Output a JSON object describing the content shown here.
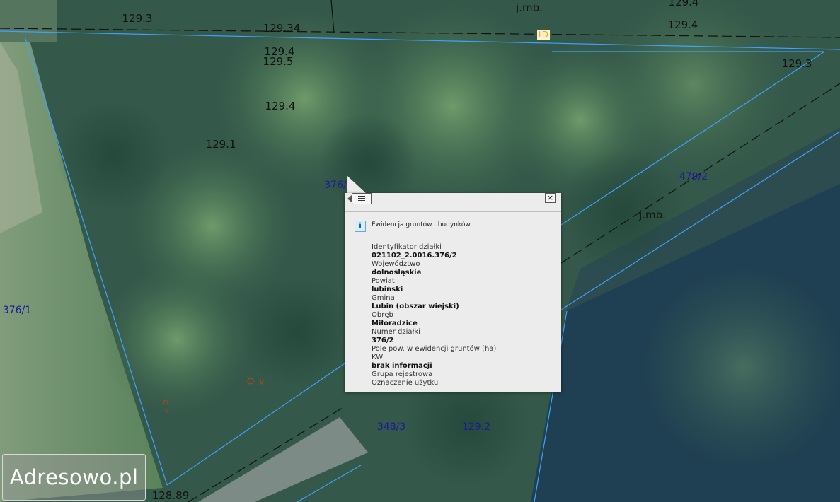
{
  "colors": {
    "parcel_line": "#3fa2ff",
    "dashed_line": "#111111",
    "parcel_label": "#1a1a9a",
    "popup_bg": "#ececec"
  },
  "map": {
    "elevations": [
      "129.3",
      "129.34",
      "129.4",
      "129.5",
      "129.4",
      "129.1",
      "129.4",
      "129.4",
      "129.3",
      "128.89",
      "j.mb.",
      "j.mb."
    ],
    "parcels": [
      "376/",
      "376/1",
      "479/2",
      "348/3",
      "129.2"
    ],
    "marker_label": "tD",
    "point_label": "k"
  },
  "popup": {
    "list_icon": "list-icon",
    "close_icon": "close-icon",
    "close_symbol": "×",
    "info_icon_symbol": "i",
    "title": "Ewidencja gruntów i budynków",
    "fields": [
      {
        "label": "Identyfikator działki",
        "value": "021102_2.0016.376/2"
      },
      {
        "label": "Województwo",
        "value": "dolnośląskie"
      },
      {
        "label": "Powiat",
        "value": "lubiński"
      },
      {
        "label": "Gmina",
        "value": "Lubin (obszar wiejski)"
      },
      {
        "label": "Obręb",
        "value": "Miłoradzice"
      },
      {
        "label": "Numer działki",
        "value": "376/2"
      },
      {
        "label": "Pole pow. w ewidencji gruntów (ha)",
        "value": ""
      },
      {
        "label": "KW",
        "value": "brak informacji"
      },
      {
        "label": "Grupa rejestrowa",
        "value": ""
      },
      {
        "label": "Oznaczenie użytku",
        "value": ""
      }
    ]
  },
  "logo": {
    "text": "Adresowo.pl"
  }
}
